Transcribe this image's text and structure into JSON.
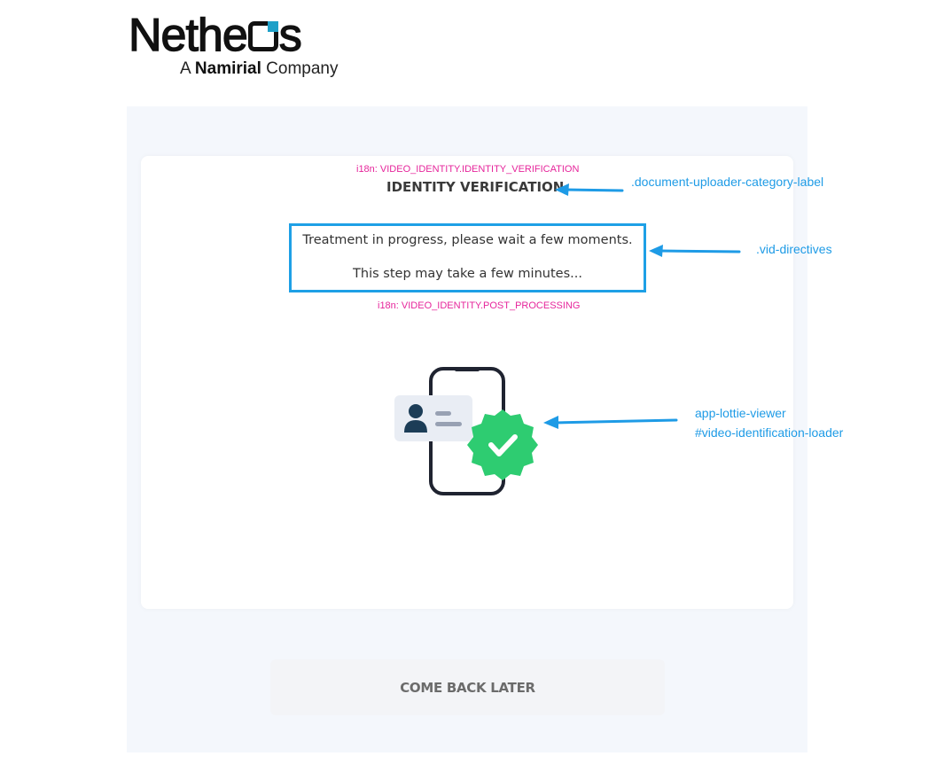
{
  "logo": {
    "wordmark_start": "Neth",
    "wordmark_mid": "e",
    "wordmark_end": "s",
    "tagline_prefix": "A",
    "tagline_brand": "Namirial",
    "tagline_suffix": "Company",
    "accent_color": "#1ea0c8"
  },
  "card": {
    "i18n_title_key": "i18n: VIDEO_IDENTITY.IDENTITY_VERIFICATION",
    "title": "IDENTITY VERIFICATION",
    "directives": {
      "line1": "Treatment in progress, please wait a few moments.",
      "line2": "This step may take a few minutes..."
    },
    "i18n_post_key": "i18n: VIDEO_IDENTITY.POST_PROCESSING",
    "loader_icon": "phone-id-verified-icon"
  },
  "annotations": {
    "label_selector": ".document-uploader-category-label",
    "directives_selector": ".vid-directives",
    "loader_selector_1": "app-lottie-viewer",
    "loader_selector_2": "#video-identification-loader",
    "annotation_color": "#1e9be6",
    "i18n_color": "#e6259b"
  },
  "actions": {
    "come_back_later": "COME BACK LATER"
  },
  "colors": {
    "panel_bg": "#f4f7fc",
    "directives_border": "#1ea0e6",
    "badge_green": "#2ecc71"
  }
}
